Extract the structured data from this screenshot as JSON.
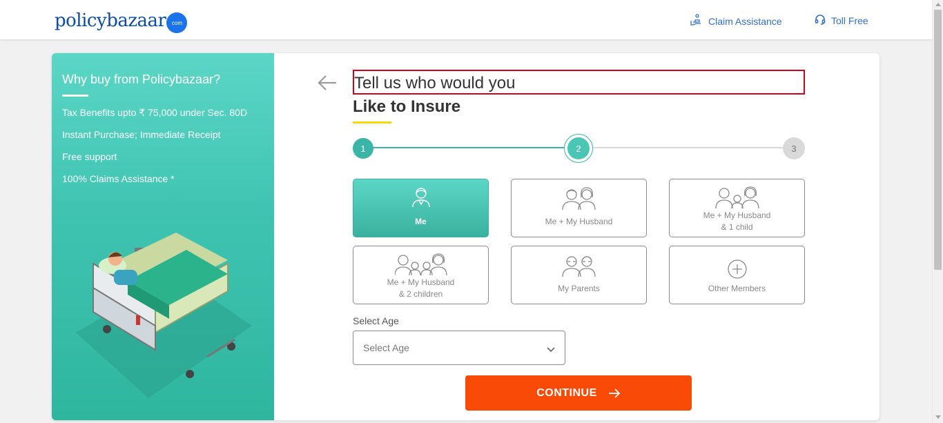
{
  "header": {
    "logo_main": "policy",
    "logo_second": "bazaar",
    "logo_badge": "com",
    "claim_label": "Claim Assistance",
    "toll_label": "Toll Free"
  },
  "sidebar": {
    "heading": "Why buy from Policybazaar?",
    "benefits": [
      "Tax Benefits upto ₹ 75,000 under Sec. 80D",
      "Instant Purchase; Immediate Receipt",
      "Free support",
      "100% Claims Assistance *"
    ]
  },
  "main": {
    "title_line1": "Tell us who would you",
    "title_line2": "Like to Insure",
    "steps": [
      {
        "number": "1",
        "state": "done"
      },
      {
        "number": "2",
        "state": "active"
      },
      {
        "number": "3",
        "state": "todo"
      }
    ],
    "options": [
      {
        "line1": "Me",
        "line2": "",
        "selected": true,
        "icon": "single-person-icon"
      },
      {
        "line1": "Me + My Husband",
        "line2": "",
        "selected": false,
        "icon": "couple-icon"
      },
      {
        "line1": "Me + My Husband",
        "line2": "& 1 child",
        "selected": false,
        "icon": "family-one-child-icon"
      },
      {
        "line1": "Me + My Husband",
        "line2": "& 2 children",
        "selected": false,
        "icon": "family-two-children-icon"
      },
      {
        "line1": "My Parents",
        "line2": "",
        "selected": false,
        "icon": "parents-icon"
      },
      {
        "line1": "Other Members",
        "line2": "",
        "selected": false,
        "icon": "plus-circle-icon"
      }
    ],
    "age_label": "Select Age",
    "age_placeholder": "Select Age",
    "continue_label": "CONTINUE"
  },
  "colors": {
    "teal": "#3bb5a5",
    "orange": "#f94a08",
    "brand_blue": "#0a4da2",
    "highlight_red": "#d0021b",
    "yellow": "#f5d90a"
  }
}
